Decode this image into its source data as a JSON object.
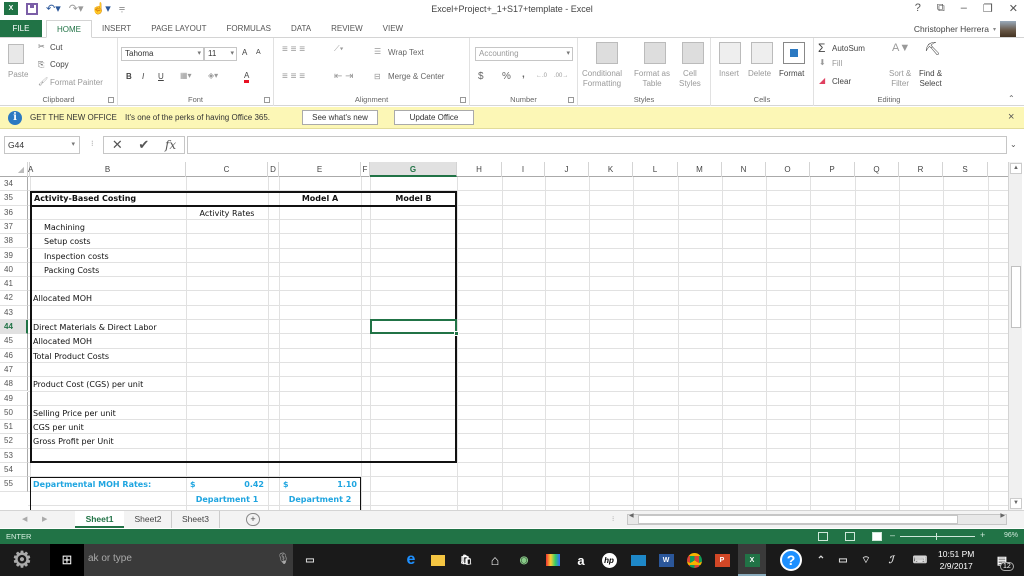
{
  "window": {
    "title": "Excel+Project+_1+S17+template - Excel",
    "help": "?",
    "controls": [
      "restore-ribbon",
      "minimize",
      "maximize",
      "close"
    ]
  },
  "quick_access": {
    "app_icon": "excel-logo-icon",
    "save": "save-icon",
    "undo": "undo-icon",
    "redo": "redo-icon",
    "touch": "touch-mode-icon",
    "customize": "customize-icon"
  },
  "tabs": [
    {
      "label": "FILE"
    },
    {
      "label": "HOME",
      "active": true
    },
    {
      "label": "INSERT"
    },
    {
      "label": "PAGE LAYOUT"
    },
    {
      "label": "FORMULAS"
    },
    {
      "label": "DATA"
    },
    {
      "label": "REVIEW"
    },
    {
      "label": "VIEW"
    }
  ],
  "user": {
    "name": "Christopher Herrera"
  },
  "ribbon": {
    "clipboard": {
      "label": "Clipboard",
      "paste": "Paste",
      "cut": "Cut",
      "copy": "Copy",
      "format_painter": "Format Painter"
    },
    "font": {
      "label": "Font",
      "font_name": "Tahoma",
      "font_size": "11",
      "bold": "B",
      "italic": "I",
      "underline": "U",
      "grow": "A",
      "shrink": "A",
      "font_color": "A",
      "font_color_hex": "#e81123"
    },
    "alignment": {
      "label": "Alignment",
      "wrap_text": "Wrap Text",
      "merge_center": "Merge & Center"
    },
    "number": {
      "label": "Number",
      "format": "Accounting",
      "currency": "$",
      "percent": "%",
      "comma": ",",
      "inc_decimal": "←.0",
      "dec_decimal": ".00→"
    },
    "styles": {
      "label": "Styles",
      "conditional": [
        "Conditional",
        "Formatting"
      ],
      "format_table": [
        "Format as",
        "Table"
      ],
      "cell_styles": [
        "Cell",
        "Styles"
      ]
    },
    "cells": {
      "label": "Cells",
      "insert": "Insert",
      "delete": "Delete",
      "format": "Format"
    },
    "editing": {
      "label": "Editing",
      "autosum": "AutoSum",
      "fill": "Fill",
      "clear": "Clear",
      "sort_filter": [
        "Sort &",
        "Filter"
      ],
      "find_select": [
        "Find &",
        "Select"
      ]
    }
  },
  "message_bar": {
    "title": "GET THE NEW OFFICE",
    "text": "It's one of the perks of having Office 365.",
    "btn_whats_new": "See what's new",
    "btn_update": "Update Office",
    "close": "×"
  },
  "formula_bar": {
    "name_box": "G44",
    "cancel": "✕",
    "enter": "✔",
    "fx": "fx",
    "formula": ""
  },
  "columns": [
    "A",
    "B",
    "C",
    "D",
    "E",
    "F",
    "G",
    "H",
    "I",
    "J",
    "K",
    "L",
    "M",
    "N",
    "O",
    "P",
    "Q",
    "R",
    "S"
  ],
  "selected_column": "G",
  "rows": [
    "34",
    "35",
    "36",
    "37",
    "38",
    "39",
    "40",
    "41",
    "42",
    "43",
    "44",
    "45",
    "46",
    "47",
    "48",
    "49",
    "50",
    "51",
    "52",
    "53",
    "54",
    "55"
  ],
  "selected_row": "44",
  "selected_cell": "G44",
  "sheet": {
    "title": "Activity-Based Costing",
    "model_a": "Model A",
    "model_b": "Model B",
    "activity_rates": "Activity Rates",
    "activities": [
      "Machining",
      "Setup costs",
      "Inspection costs",
      "Packing Costs"
    ],
    "allocated_moh": "Allocated MOH",
    "direct_materials_labor": "Direct Materials & Direct Labor",
    "allocated_moh_2": "Allocated MOH",
    "total_product_costs": "Total Product Costs",
    "product_cost_per_unit": "Product Cost (CGS) per unit",
    "selling_price": "Selling Price per unit",
    "cgs_per_unit": "CGS per unit",
    "gross_profit": "Gross Profit per Unit",
    "dept_moh_label": "Departmental MOH Rates:",
    "dept1": {
      "currency": "$",
      "rate": "0.42",
      "label": "Department 1"
    },
    "dept2": {
      "currency": "$",
      "rate": "1.10",
      "label": "Department 2"
    },
    "accent_color": "#1fa5e0"
  },
  "sheet_tabs": [
    {
      "label": "Sheet1",
      "active": true
    },
    {
      "label": "Sheet2"
    },
    {
      "label": "Sheet3"
    }
  ],
  "add_sheet": "+",
  "status": {
    "mode": "ENTER",
    "zoom": "96%",
    "zoom_fraction": 0.48
  },
  "taskbar": {
    "search_placeholder": "ak or type",
    "time": "10:51 PM",
    "date": "2/9/2017",
    "notifications": "12",
    "apps": [
      "edge",
      "file-explorer",
      "store",
      "home",
      "webcam",
      "puzzle",
      "amazon",
      "hp",
      "weather",
      "word",
      "chrome",
      "powerpoint",
      "excel"
    ]
  }
}
